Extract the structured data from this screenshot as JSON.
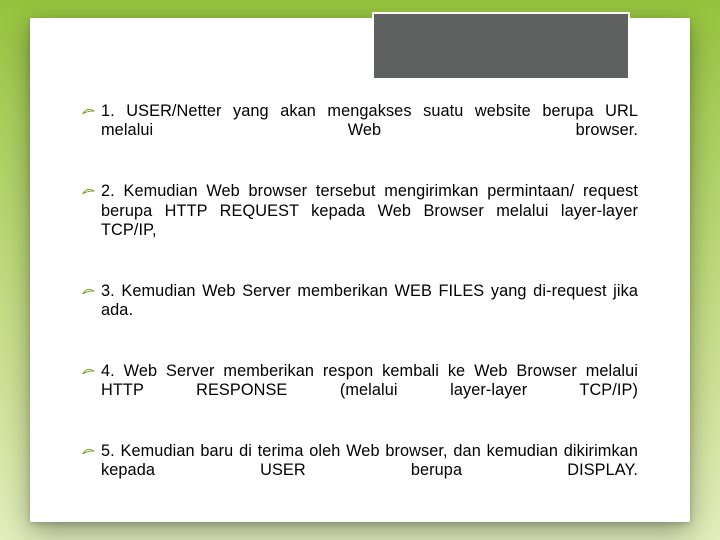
{
  "colors": {
    "bulletStroke": "#6b9b1a"
  },
  "items": [
    {
      "number": "1.",
      "body": "USER/Netter yang akan mengakses suatu website berupa URL melalui Web browser."
    },
    {
      "number": "2.",
      "body": "Kemudian Web browser tersebut mengirimkan permintaan/ request berupa HTTP REQUEST kepada Web Browser melalui layer-layer TCP/IP,"
    },
    {
      "number": "3.",
      "body": "Kemudian Web Server memberikan WEB FILES yang di-request jika ada."
    },
    {
      "number": "4.",
      "body": "Web Server memberikan respon kembali ke Web Browser melalui HTTP RESPONSE (melalui layer-layer TCP/IP)"
    },
    {
      "number": "5.",
      "body": "Kemudian baru di terima oleh Web browser, dan kemudian dikirimkan kepada USER berupa DISPLAY."
    }
  ]
}
